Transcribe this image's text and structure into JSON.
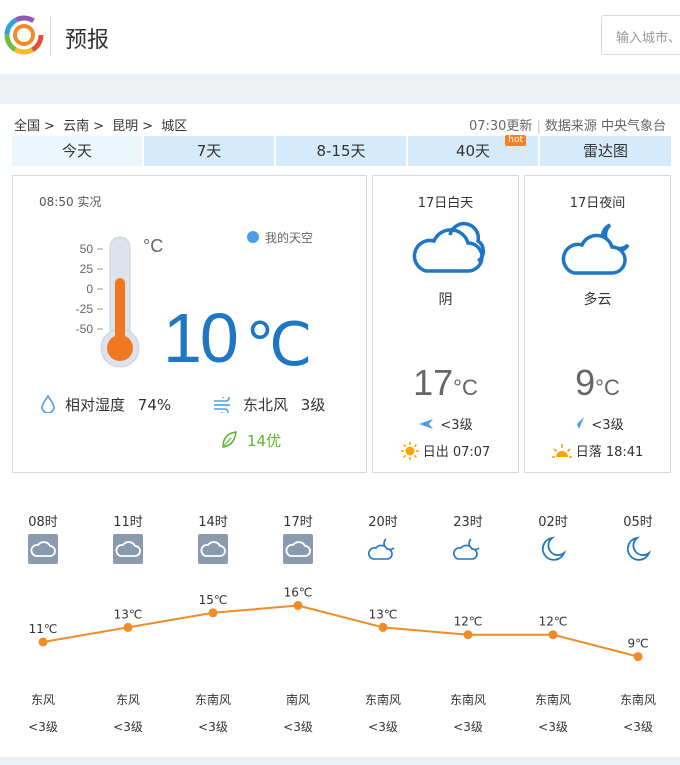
{
  "header": {
    "title": "预报",
    "search_placeholder": "输入城市、"
  },
  "breadcrumb": {
    "items": [
      "全国",
      "云南",
      "昆明",
      "城区"
    ],
    "separator": ">",
    "updated": "07:30更新",
    "source_label": "数据来源",
    "source": "中央气象台"
  },
  "tabs": [
    {
      "label": "今天",
      "active": true
    },
    {
      "label": "7天",
      "active": false
    },
    {
      "label": "8-15天",
      "active": false
    },
    {
      "label": "40天",
      "active": false,
      "badge": "hot"
    },
    {
      "label": "雷达图",
      "active": false
    }
  ],
  "current": {
    "obs_time": "08:50 实况",
    "my_sky": "我的天空",
    "temp": "10",
    "unit": "℃",
    "thermometer_scale": [
      "50",
      "25",
      "0",
      "-25",
      "-50"
    ],
    "thermometer_unit": "°C",
    "humidity_label": "相对湿度",
    "humidity": "74%",
    "wind_dir": "东北风",
    "wind_level": "3级",
    "aqi": "14优"
  },
  "day": {
    "title": "17日白天",
    "icon": "cloudy-icon",
    "condition": "阴",
    "temp": "17",
    "unit": "°C",
    "wind": "<3级",
    "sun_label": "日出",
    "sun_time": "07:07"
  },
  "night": {
    "title": "17日夜间",
    "icon": "cloudy-night-icon",
    "condition": "多云",
    "temp": "9",
    "unit": "°C",
    "wind": "<3级",
    "sun_label": "日落",
    "sun_time": "18:41"
  },
  "colors": {
    "accent_blue": "#1f76c3",
    "tab_bg": "#d5ebfb",
    "line_orange": "#f08c28",
    "aqi_green": "#5cb531"
  },
  "chart_data": {
    "type": "line",
    "x": [
      "08时",
      "11时",
      "14时",
      "17时",
      "20时",
      "23时",
      "02时",
      "05时"
    ],
    "series": [
      {
        "values": [
          11,
          13,
          15,
          16,
          13,
          12,
          12,
          9
        ]
      }
    ],
    "data_labels": [
      "11℃",
      "13℃",
      "15℃",
      "16℃",
      "13℃",
      "12℃",
      "12℃",
      "9℃"
    ],
    "icons": [
      "cloudy-icon",
      "cloudy-icon",
      "cloudy-icon",
      "cloudy-icon",
      "cloudy-night-icon",
      "cloudy-night-icon",
      "moon-icon",
      "moon-icon"
    ],
    "wind_dirs": [
      "东风",
      "东风",
      "东南风",
      "南风",
      "东南风",
      "东南风",
      "东南风",
      "东南风"
    ],
    "wind_levels": [
      "<3级",
      "<3级",
      "<3级",
      "<3级",
      "<3级",
      "<3级",
      "<3级",
      "<3级"
    ]
  }
}
